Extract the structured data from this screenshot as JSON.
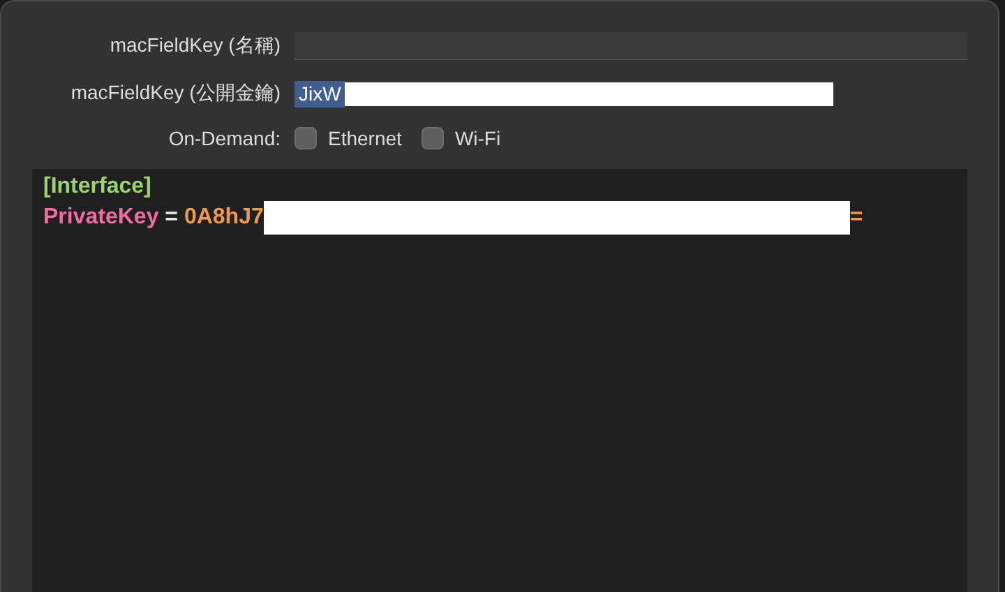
{
  "fields": [
    {
      "label": "macFieldKey (名稱)",
      "selected": false,
      "redacted": false
    },
    {
      "label": "macFieldKey (公開金鑰)",
      "value": "JixW",
      "selected": true,
      "redacted": true
    }
  ],
  "on_demand": {
    "label": "On-Demand:",
    "options": [
      {
        "label": "Ethernet",
        "checked": false
      },
      {
        "label": "Wi-Fi",
        "checked": false
      }
    ]
  },
  "editor": {
    "lines": [
      [
        {
          "kind": "section",
          "text": "[Interface]"
        }
      ],
      [
        {
          "kind": "key",
          "text": "PrivateKey"
        },
        {
          "kind": "op",
          "text": " = "
        },
        {
          "kind": "value",
          "text": "0A8hJ7"
        },
        {
          "kind": "redaction"
        },
        {
          "kind": "value",
          "text": "="
        }
      ]
    ]
  }
}
